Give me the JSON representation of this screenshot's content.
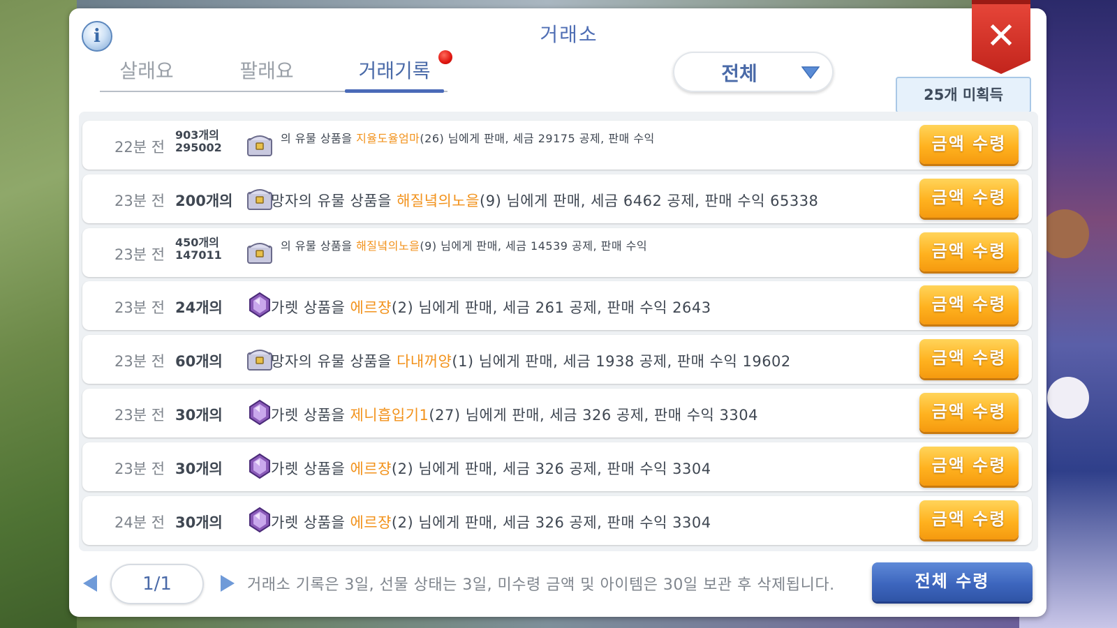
{
  "window": {
    "title": "거래소",
    "info_icon": "i",
    "close_icon": "✕"
  },
  "tabs": [
    {
      "label": "살래요",
      "active": false
    },
    {
      "label": "팔래요",
      "active": false
    },
    {
      "label": "거래기록",
      "active": true,
      "has_notification": true
    }
  ],
  "filter": {
    "selected": "전체"
  },
  "unclaimed_badge": "25개 미획득",
  "records": [
    {
      "time": "22분 전",
      "qty": "903개의\n295002",
      "icon": "relic-chest-icon",
      "pre": "의 유물 상품을 ",
      "buyer": "지율도율엄마",
      "post": "(26) 님에게 판매, 세금 29175 공제, 판매 수익",
      "button": "금액 수령"
    },
    {
      "time": "23분 전",
      "qty": "200개의",
      "icon": "relic-chest-icon",
      "pre": "망자의 유물 상품을 ",
      "buyer": "해질녘의노을",
      "post": "(9) 님에게 판매, 세금 6462 공제, 판매 수익 65338",
      "button": "금액 수령"
    },
    {
      "time": "23분 전",
      "qty": "450개의\n147011",
      "icon": "relic-chest-icon",
      "pre": "의 유물 상품을 ",
      "buyer": "해질녘의노을",
      "post": "(9) 님에게 판매, 세금 14539 공제, 판매 수익",
      "button": "금액 수령"
    },
    {
      "time": "23분 전",
      "qty": "24개의",
      "icon": "garnet-gem-icon",
      "pre": "가렛 상품을 ",
      "buyer": "에르쟝",
      "post": "(2) 님에게 판매, 세금 261 공제, 판매 수익 2643",
      "button": "금액 수령"
    },
    {
      "time": "23분 전",
      "qty": "60개의",
      "icon": "relic-chest-icon",
      "pre": "망자의 유물 상품을 ",
      "buyer": "다내꺼양",
      "post": "(1) 님에게 판매, 세금 1938 공제, 판매 수익 19602",
      "button": "금액 수령"
    },
    {
      "time": "23분 전",
      "qty": "30개의",
      "icon": "garnet-gem-icon",
      "pre": "가렛 상품을 ",
      "buyer": "제니흡입기1",
      "post": "(27) 님에게 판매, 세금 326 공제, 판매 수익 3304",
      "button": "금액 수령"
    },
    {
      "time": "23분 전",
      "qty": "30개의",
      "icon": "garnet-gem-icon",
      "pre": "가렛 상품을 ",
      "buyer": "에르쟝",
      "post": "(2) 님에게 판매, 세금 326 공제, 판매 수익 3304",
      "button": "금액 수령"
    },
    {
      "time": "24분 전",
      "qty": "30개의",
      "icon": "garnet-gem-icon",
      "pre": "가렛 상품을 ",
      "buyer": "에르쟝",
      "post": "(2) 님에게 판매, 세금 326 공제, 판매 수익 3304",
      "button": "금액 수령"
    }
  ],
  "footer": {
    "page": "1/1",
    "note": "거래소 기록은 3일, 선물 상태는 3일, 미수령 금액 및 아이템은 30일 보관 후 삭제됩니다.",
    "claim_all": "전체 수령"
  },
  "colors": {
    "buyer_name": "#f2921b",
    "accent_blue": "#4a6aa8",
    "claim_button": "#ffb21f",
    "claim_all_button": "#3d66be",
    "close_button": "#d8332a"
  }
}
